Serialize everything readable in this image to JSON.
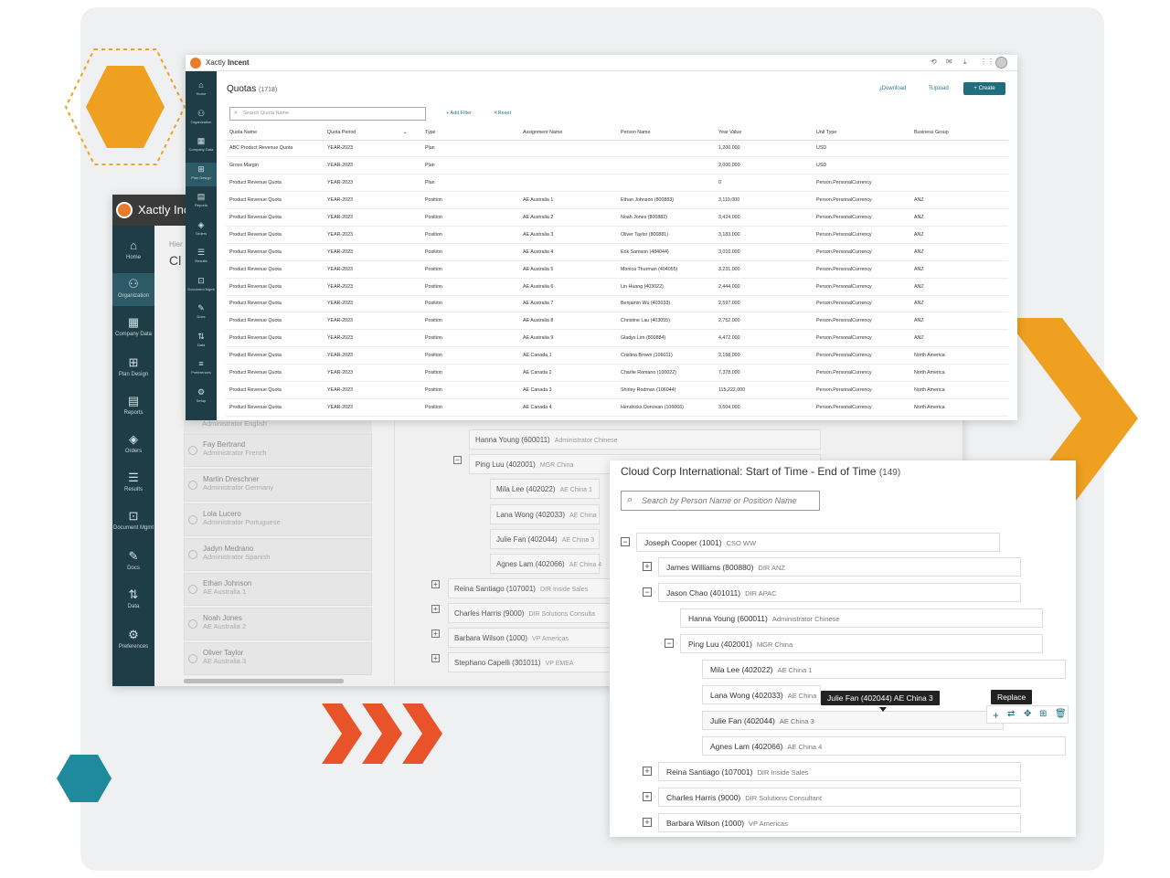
{
  "decor": {
    "orange": "#f0a020",
    "teal": "#1e8a9c",
    "chevron": "#e8532a",
    "sidebar": "#1e3d47",
    "accent": "#1f6e7e"
  },
  "back": {
    "brand": "Xactly Inc",
    "breadcrumb": "Hier",
    "page_title": "Cl",
    "nav": [
      {
        "icon": "home-icon",
        "glyph": "⌂",
        "label": "Home"
      },
      {
        "icon": "organization-icon",
        "glyph": "⚇",
        "label": "Organization"
      },
      {
        "icon": "company-data-icon",
        "glyph": "▦",
        "label": "Company Data"
      },
      {
        "icon": "plan-design-icon",
        "glyph": "⊞",
        "label": "Plan Design"
      },
      {
        "icon": "reports-icon",
        "glyph": "▤",
        "label": "Reports"
      },
      {
        "icon": "orders-icon",
        "glyph": "◈",
        "label": "Orders"
      },
      {
        "icon": "results-icon",
        "glyph": "☰",
        "label": "Results"
      },
      {
        "icon": "document-mgmt-icon",
        "glyph": "⊡",
        "label": "Document Mgmt"
      },
      {
        "icon": "docs-icon",
        "glyph": "✎",
        "label": "Docs"
      },
      {
        "icon": "data-icon",
        "glyph": "⇅",
        "label": "Data"
      },
      {
        "icon": "preferences-icon",
        "glyph": "⚙",
        "label": "Preferences"
      }
    ],
    "list_top_text": "Administrator English",
    "list": [
      {
        "name": "Fay Bertrand",
        "role": "Administrator French"
      },
      {
        "name": "Martin Dreschner",
        "role": "Administrator Germany"
      },
      {
        "name": "Lola Lucero",
        "role": "Administrator Portuguese"
      },
      {
        "name": "Jadyn Medrano",
        "role": "Administrator Spanish"
      },
      {
        "name": "Ethan Johnson",
        "role": "AE Australia 1"
      },
      {
        "name": "Noah Jones",
        "role": "AE Australia 2"
      },
      {
        "name": "Oliver Taylor",
        "role": "AE Australia 3"
      }
    ],
    "tree": [
      {
        "name": "Hanna Young (600011)",
        "role": "Administrator Chinese"
      },
      {
        "name": "Ping Luu (402001)",
        "role": "MGR China"
      },
      {
        "name": "Mila Lee (402022)",
        "role": "AE China 1"
      },
      {
        "name": "Lana Wong (402033)",
        "role": "AE China"
      },
      {
        "name": "Julie Fan (402044)",
        "role": "AE China 3"
      },
      {
        "name": "Agnes Lam (402066)",
        "role": "AE China 4"
      },
      {
        "name": "Reina Santiago (107001)",
        "role": "DIR Inside Sales"
      },
      {
        "name": "Charles Harris (9000)",
        "role": "DIR Solutions Consulta"
      },
      {
        "name": "Barbara Wilson (1000)",
        "role": "VP Americas"
      },
      {
        "name": "Stephano Capelli (301011)",
        "role": "VP EMEA"
      }
    ]
  },
  "quota": {
    "brand_prefix": "Xactly",
    "brand_bold": "Incent",
    "title": "Quotas",
    "count": "(1718)",
    "download": "⤓Download",
    "upload": "⤒Upload",
    "create": "+ Create",
    "search_placeholder": "Search Quota Name",
    "add_filter": "+ Add Filter",
    "reset": "✕Reset",
    "nav": [
      {
        "icon": "home-icon",
        "glyph": "⌂",
        "label": "Home"
      },
      {
        "icon": "organization-icon",
        "glyph": "⚇",
        "label": "Organization"
      },
      {
        "icon": "company-data-icon",
        "glyph": "▦",
        "label": "Company Data"
      },
      {
        "icon": "plan-design-icon",
        "glyph": "⊞",
        "label": "Plan Design"
      },
      {
        "icon": "reports-icon",
        "glyph": "▤",
        "label": "Reports"
      },
      {
        "icon": "orders-icon",
        "glyph": "◈",
        "label": "Orders"
      },
      {
        "icon": "results-icon",
        "glyph": "☰",
        "label": "Results"
      },
      {
        "icon": "document-mgmt-icon",
        "glyph": "⊡",
        "label": "Document Mgmt"
      },
      {
        "icon": "docs-icon",
        "glyph": "✎",
        "label": "Docs"
      },
      {
        "icon": "data-icon",
        "glyph": "⇅",
        "label": "Data"
      },
      {
        "icon": "preferences-icon",
        "glyph": "≡",
        "label": "Preferences"
      },
      {
        "icon": "setup-icon",
        "glyph": "⚙",
        "label": "Setup"
      }
    ],
    "columns": [
      "Quota Name",
      "Quota Period",
      "Type",
      "Assignment Name",
      "Person Name",
      "Year Value",
      "Unit Type",
      "Business Group"
    ],
    "rows": [
      [
        "ABC Product Revenue Quota",
        "YEAR-2023",
        "Plan",
        "",
        "",
        "1,200,000",
        "USD",
        ""
      ],
      [
        "Gross Margin",
        "YEAR-2023",
        "Plan",
        "",
        "",
        "2,000,000",
        "USD",
        ""
      ],
      [
        "Product Revenue Quota",
        "YEAR-2023",
        "Plan",
        "",
        "",
        "0",
        "Person.PersonalCurrency",
        ""
      ],
      [
        "Product Revenue Quota",
        "YEAR-2023",
        "Position",
        "AE Australia 1",
        "Ethan Johnson (800883)",
        "3,110,000",
        "Person.PersonalCurrency",
        "ANZ"
      ],
      [
        "Product Revenue Quota",
        "YEAR-2023",
        "Position",
        "AE Australia 2",
        "Noah Jones (800882)",
        "3,424,000",
        "Person.PersonalCurrency",
        "ANZ"
      ],
      [
        "Product Revenue Quota",
        "YEAR-2023",
        "Position",
        "AE Australia 3",
        "Oliver Taylor (800881)",
        "3,183,000",
        "Person.PersonalCurrency",
        "ANZ"
      ],
      [
        "Product Revenue Quota",
        "YEAR-2023",
        "Position",
        "AE Australia 4",
        "Erik Samson (484044)",
        "3,010,000",
        "Person.PersonalCurrency",
        "ANZ"
      ],
      [
        "Product Revenue Quota",
        "YEAR-2023",
        "Position",
        "AE Australia 5",
        "Monica Thurman (404055)",
        "3,231,000",
        "Person.PersonalCurrency",
        "ANZ"
      ],
      [
        "Product Revenue Quota",
        "YEAR-2023",
        "Position",
        "AE Australia 6",
        "Lin Huang (403022)",
        "2,444,000",
        "Person.PersonalCurrency",
        "ANZ"
      ],
      [
        "Product Revenue Quota",
        "YEAR-2023",
        "Position",
        "AE Australia 7",
        "Benjamin Wu (403033)",
        "2,597,000",
        "Person.PersonalCurrency",
        "ANZ"
      ],
      [
        "Product Revenue Quota",
        "YEAR-2023",
        "Position",
        "AE Australia 8",
        "Christine Lau (403055)",
        "2,752,000",
        "Person.PersonalCurrency",
        "ANZ"
      ],
      [
        "Product Revenue Quota",
        "YEAR-2023",
        "Position",
        "AE Australia 9",
        "Gladys Lim (800884)",
        "4,472,000",
        "Person.PersonalCurrency",
        "ANZ"
      ],
      [
        "Product Revenue Quota",
        "YEAR-2023",
        "Position",
        "AE Canada 1",
        "Cristina Brown (106011)",
        "2,158,000",
        "Person.PersonalCurrency",
        "North America"
      ],
      [
        "Product Revenue Quota",
        "YEAR-2023",
        "Position",
        "AE Canada 2",
        "Charlie Romano (100022)",
        "7,378,000",
        "Person.PersonalCurrency",
        "North America"
      ],
      [
        "Product Revenue Quota",
        "YEAR-2023",
        "Position",
        "AE Canada 3",
        "Shirley Rodman (106044)",
        "115,222,000",
        "Person.PersonalCurrency",
        "North America"
      ],
      [
        "Product Revenue Quota",
        "YEAR-2023",
        "Position",
        "AE Canada 4",
        "Hendricks Donovan (106066)",
        "3,504,000",
        "Person.PersonalCurrency",
        "North America"
      ]
    ]
  },
  "hier": {
    "title": "Cloud Corp International: Start of Time - End of Time",
    "count": "(149)",
    "search_placeholder": "Search by Person Name or Position Name",
    "tooltip": "Julie Fan (402044) AE China 3",
    "replace_label": "Replace",
    "nodes": [
      {
        "name": "Joseph Cooper (1001)",
        "role": "CSO WW",
        "toggle": "−"
      },
      {
        "name": "James Williams (800880)",
        "role": "DIR ANZ",
        "toggle": "+"
      },
      {
        "name": "Jason Chao (401011)",
        "role": "DIR APAC",
        "toggle": "−"
      },
      {
        "name": "Hanna Young (600011)",
        "role": "Administrator Chinese",
        "toggle": ""
      },
      {
        "name": "Ping Luu (402001)",
        "role": "MGR China",
        "toggle": "−"
      },
      {
        "name": "Mila Lee (402022)",
        "role": "AE China 1",
        "toggle": ""
      },
      {
        "name": "Lana Wong (402033)",
        "role": "AE China",
        "toggle": ""
      },
      {
        "name": "Julie Fan (402044)",
        "role": "AE China 3",
        "toggle": ""
      },
      {
        "name": "Agnes Lam (402066)",
        "role": "AE China 4",
        "toggle": ""
      },
      {
        "name": "Reina Santiago (107001)",
        "role": "DIR Inside Sales",
        "toggle": "+"
      },
      {
        "name": "Charles Harris (9000)",
        "role": "DIR Solutions Consultant",
        "toggle": "+"
      },
      {
        "name": "Barbara Wilson (1000)",
        "role": "VP Americas",
        "toggle": "+"
      }
    ]
  }
}
